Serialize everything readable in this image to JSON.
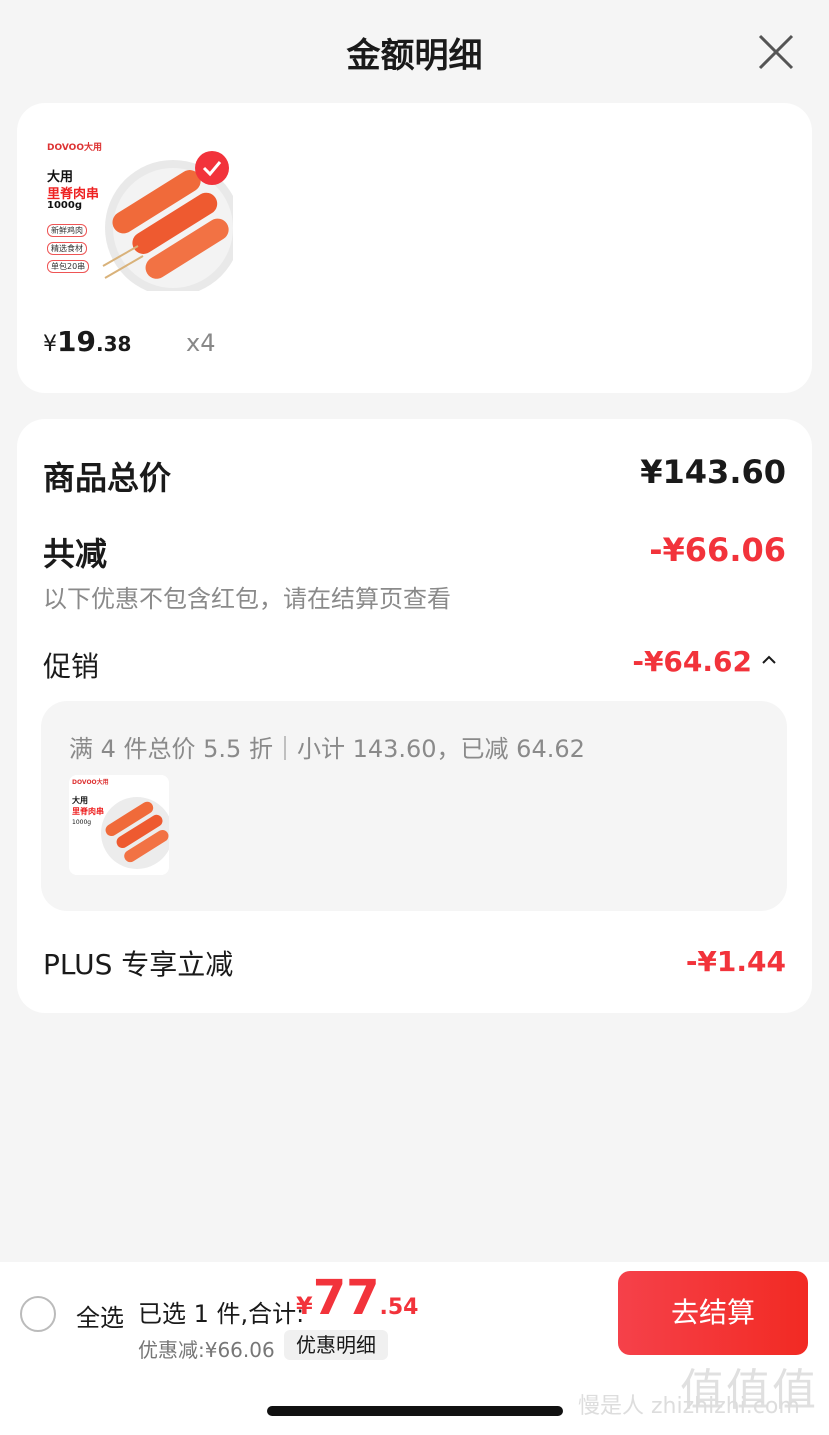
{
  "header": {
    "title": "金额明细"
  },
  "product": {
    "brand": "DOVOO大用",
    "image_title_line1": "大用",
    "image_title_line2": "里脊肉串",
    "image_weight": "1000g",
    "image_tags": [
      "新鲜鸡肉",
      "精选食材",
      "单包20串"
    ],
    "price_symbol": "¥",
    "price_int": "19",
    "price_dec": ".38",
    "quantity": "x4"
  },
  "summary": {
    "total_label": "商品总价",
    "total_value": "¥143.60",
    "reduce_label": "共减",
    "reduce_value": "-¥66.06",
    "reduce_note": "以下优惠不包含红包，请在结算页查看",
    "promo_label": "促销",
    "promo_value": "-¥64.62",
    "promo_detail": "满 4 件总价 5.5 折｜小计 143.60，已减 64.62",
    "plus_label": "PLUS 专享立减",
    "plus_value": "-¥1.44"
  },
  "bottom_bar": {
    "select_all_label": "全选",
    "selected_info": "已选 1 件,合计:",
    "total_symbol": "¥",
    "total_int": "77",
    "total_dec": ".54",
    "discount_line": "优惠减:¥66.06",
    "detail_chip": "优惠明细",
    "checkout_label": "去结算",
    "watermark_text": "慢是人 zhizhizhi.com",
    "watermark_logo": "值值值"
  },
  "colors": {
    "accent_red": "#f2333b",
    "background": "#f5f5f5"
  }
}
